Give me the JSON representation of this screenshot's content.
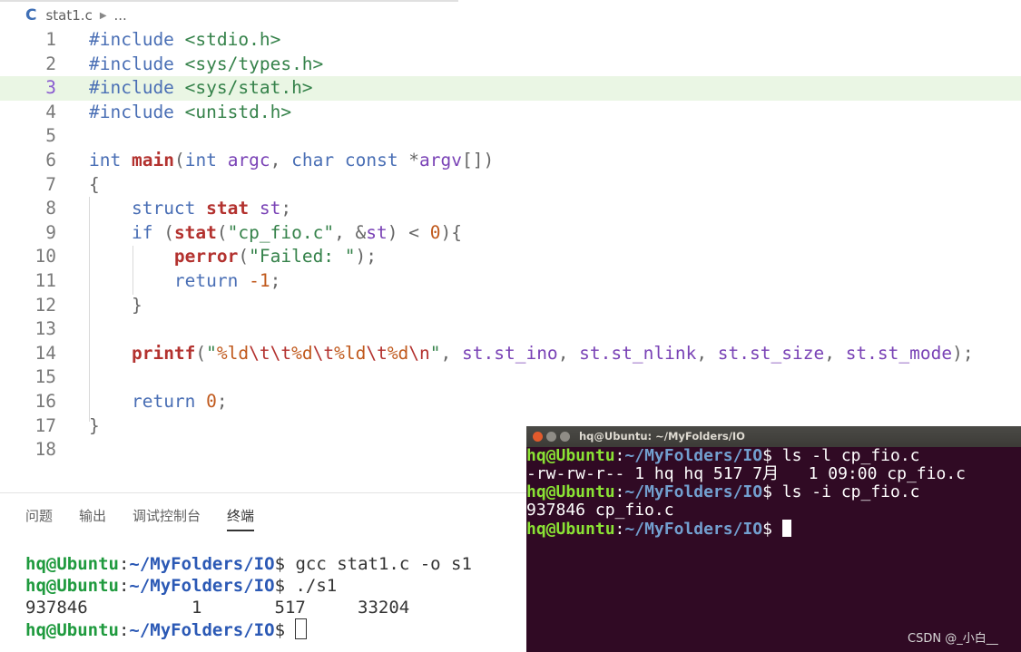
{
  "editor": {
    "breadcrumb": {
      "lang_icon": "C",
      "file": "stat1.c",
      "more": "..."
    },
    "current_line": 3,
    "lines": [
      [
        {
          "t": "#include",
          "c": "dir"
        },
        {
          "t": " ",
          "c": "pn"
        },
        {
          "t": "<stdio.h>",
          "c": "inc"
        }
      ],
      [
        {
          "t": "#include",
          "c": "dir"
        },
        {
          "t": " ",
          "c": "pn"
        },
        {
          "t": "<sys/types.h>",
          "c": "inc"
        }
      ],
      [
        {
          "t": "#include",
          "c": "dir"
        },
        {
          "t": " ",
          "c": "pn"
        },
        {
          "t": "<sys/stat.h>",
          "c": "inc"
        }
      ],
      [
        {
          "t": "#include",
          "c": "dir"
        },
        {
          "t": " ",
          "c": "pn"
        },
        {
          "t": "<unistd.h>",
          "c": "inc"
        }
      ],
      [],
      [
        {
          "t": "int",
          "c": "kw"
        },
        {
          "t": " ",
          "c": "pn"
        },
        {
          "t": "main",
          "c": "fn"
        },
        {
          "t": "(",
          "c": "pn"
        },
        {
          "t": "int",
          "c": "kw"
        },
        {
          "t": " ",
          "c": "pn"
        },
        {
          "t": "argc",
          "c": "var"
        },
        {
          "t": ", ",
          "c": "pn"
        },
        {
          "t": "char",
          "c": "kw"
        },
        {
          "t": " ",
          "c": "pn"
        },
        {
          "t": "const",
          "c": "kw"
        },
        {
          "t": " *",
          "c": "pn"
        },
        {
          "t": "argv",
          "c": "var"
        },
        {
          "t": "[])",
          "c": "pn"
        }
      ],
      [
        {
          "t": "{",
          "c": "pn"
        }
      ],
      [
        {
          "t": "    ",
          "c": "pn"
        },
        {
          "t": "struct",
          "c": "kw"
        },
        {
          "t": " ",
          "c": "pn"
        },
        {
          "t": "stat",
          "c": "fn"
        },
        {
          "t": " ",
          "c": "pn"
        },
        {
          "t": "st",
          "c": "var"
        },
        {
          "t": ";",
          "c": "pn"
        }
      ],
      [
        {
          "t": "    ",
          "c": "pn"
        },
        {
          "t": "if",
          "c": "kw"
        },
        {
          "t": " (",
          "c": "pn"
        },
        {
          "t": "stat",
          "c": "fn"
        },
        {
          "t": "(",
          "c": "pn"
        },
        {
          "t": "\"cp_fio.c\"",
          "c": "str"
        },
        {
          "t": ", &",
          "c": "pn"
        },
        {
          "t": "st",
          "c": "var"
        },
        {
          "t": ") < ",
          "c": "pn"
        },
        {
          "t": "0",
          "c": "num"
        },
        {
          "t": "){",
          "c": "pn"
        }
      ],
      [
        {
          "t": "        ",
          "c": "pn"
        },
        {
          "t": "perror",
          "c": "fn"
        },
        {
          "t": "(",
          "c": "pn"
        },
        {
          "t": "\"Failed: \"",
          "c": "str"
        },
        {
          "t": ");",
          "c": "pn"
        }
      ],
      [
        {
          "t": "        ",
          "c": "pn"
        },
        {
          "t": "return",
          "c": "kw"
        },
        {
          "t": " ",
          "c": "pn"
        },
        {
          "t": "-1",
          "c": "num"
        },
        {
          "t": ";",
          "c": "pn"
        }
      ],
      [
        {
          "t": "    ",
          "c": "pn"
        },
        {
          "t": "}",
          "c": "pn"
        }
      ],
      [],
      [
        {
          "t": "    ",
          "c": "pn"
        },
        {
          "t": "printf",
          "c": "fn"
        },
        {
          "t": "(",
          "c": "pn"
        },
        {
          "t": "\"",
          "c": "str"
        },
        {
          "t": "%ld",
          "c": "strfmt"
        },
        {
          "t": "\\t\\t",
          "c": "esc"
        },
        {
          "t": "%d",
          "c": "strfmt"
        },
        {
          "t": "\\t",
          "c": "esc"
        },
        {
          "t": "%ld",
          "c": "strfmt"
        },
        {
          "t": "\\t",
          "c": "esc"
        },
        {
          "t": "%d",
          "c": "strfmt"
        },
        {
          "t": "\\n",
          "c": "esc"
        },
        {
          "t": "\"",
          "c": "str"
        },
        {
          "t": ", ",
          "c": "pn"
        },
        {
          "t": "st.st_ino",
          "c": "var"
        },
        {
          "t": ", ",
          "c": "pn"
        },
        {
          "t": "st.st_nlink",
          "c": "var"
        },
        {
          "t": ", ",
          "c": "pn"
        },
        {
          "t": "st.st_size",
          "c": "var"
        },
        {
          "t": ", ",
          "c": "pn"
        },
        {
          "t": "st.st_mode",
          "c": "var"
        },
        {
          "t": ");",
          "c": "pn"
        }
      ],
      [],
      [
        {
          "t": "    ",
          "c": "pn"
        },
        {
          "t": "return",
          "c": "kw"
        },
        {
          "t": " ",
          "c": "pn"
        },
        {
          "t": "0",
          "c": "num"
        },
        {
          "t": ";",
          "c": "pn"
        }
      ],
      [
        {
          "t": "}",
          "c": "pn"
        }
      ],
      []
    ]
  },
  "panel": {
    "tabs": [
      {
        "label": "问题",
        "active": false
      },
      {
        "label": "输出",
        "active": false
      },
      {
        "label": "调试控制台",
        "active": false
      },
      {
        "label": "终端",
        "active": true
      }
    ],
    "terminal": [
      {
        "user": "hq@Ubuntu",
        "path": "~/MyFolders/IO",
        "cmd": "gcc stat1.c -o s1"
      },
      {
        "user": "hq@Ubuntu",
        "path": "~/MyFolders/IO",
        "cmd": "./s1"
      },
      {
        "output": "937846          1       517     33204"
      },
      {
        "user": "hq@Ubuntu",
        "path": "~/MyFolders/IO",
        "cmd": "",
        "cursor": true
      }
    ]
  },
  "ubuntu_terminal": {
    "title": "hq@Ubuntu: ~/MyFolders/IO",
    "lines": [
      {
        "user": "hq@Ubuntu",
        "path": "~/MyFolders/IO",
        "cmd": "ls -l cp_fio.c"
      },
      {
        "output": "-rw-rw-r-- 1 hq hq 517 7月   1 09:00 cp_fio.c"
      },
      {
        "user": "hq@Ubuntu",
        "path": "~/MyFolders/IO",
        "cmd": "ls -i cp_fio.c"
      },
      {
        "output": "937846 cp_fio.c"
      },
      {
        "user": "hq@Ubuntu",
        "path": "~/MyFolders/IO",
        "cmd": "",
        "cursor": true
      }
    ]
  },
  "watermark": "CSDN @_小白__",
  "colors": {
    "accent_green": "#1f9a3e",
    "accent_blue": "#2b59b5",
    "terminal_bg": "#300a24",
    "current_line_bg": "#eaf6e4"
  }
}
